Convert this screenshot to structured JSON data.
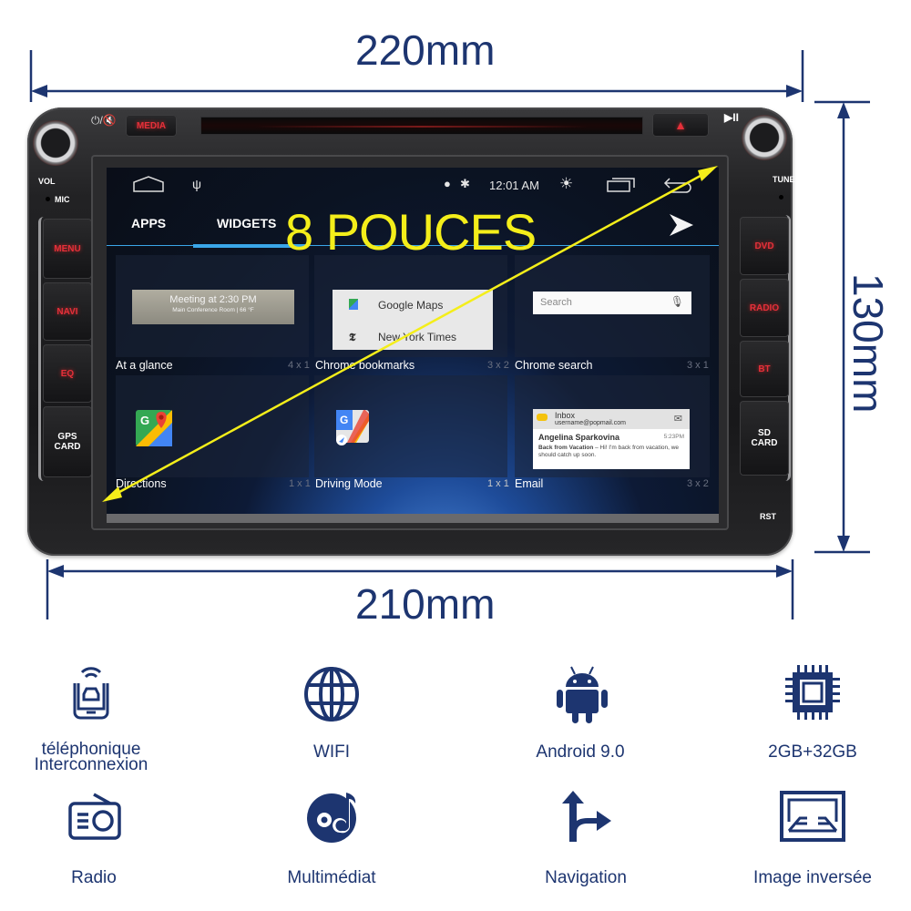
{
  "dimensions": {
    "width_top": "220mm",
    "height_right": "130mm",
    "width_bottom": "210mm",
    "screen_size_label": "8 POUCES"
  },
  "device": {
    "top_buttons": {
      "power_mute": "⏻/🔇",
      "media": "MEDIA",
      "eject": "▲",
      "play_pause": "▶II"
    },
    "knob_labels": {
      "left": "VOL",
      "mic": "MIC",
      "right": "TUNE",
      "reset": "RST"
    },
    "left_buttons": [
      "MENU",
      "NAVI",
      "EQ",
      "GPS CARD"
    ],
    "right_buttons": [
      "DVD",
      "RADIO",
      "BT",
      "SD CARD"
    ]
  },
  "screen": {
    "status_bar": {
      "time": "12:01 AM"
    },
    "tabs": [
      {
        "label": "APPS",
        "active": false
      },
      {
        "label": "WIDGETS",
        "active": true
      }
    ],
    "widgets": [
      {
        "name": "At a glance",
        "size": "4 x 1",
        "preview": {
          "title": "Meeting at 2:30 PM",
          "subtitle": "Main Conference Room | 66 °F"
        }
      },
      {
        "name": "Chrome bookmarks",
        "size": "3 x 2",
        "preview": {
          "items": [
            "Google Maps",
            "New York Times"
          ]
        }
      },
      {
        "name": "Chrome search",
        "size": "3 x 1",
        "preview": {
          "placeholder": "Search"
        }
      },
      {
        "name": "Directions",
        "size": "1 x 1"
      },
      {
        "name": "Driving Mode",
        "size": "1 x 1"
      },
      {
        "name": "Email",
        "size": "3 x 2",
        "preview": {
          "inbox": "Inbox",
          "account": "username@popmail.com",
          "sender": "Angelina Sparkovina",
          "time": "5:23PM",
          "subject": "Back from Vacation",
          "snippet": "– Hi! I'm back from vacation, we should catch up soon."
        }
      }
    ]
  },
  "features": [
    {
      "icon": "phone-car-link-icon",
      "label": "téléphonique Interconnexion"
    },
    {
      "icon": "globe-icon",
      "label": "WIFI"
    },
    {
      "icon": "android-icon",
      "label": "Android 9.0"
    },
    {
      "icon": "chip-icon",
      "label": "2GB+32GB"
    },
    {
      "icon": "radio-icon",
      "label": "Radio"
    },
    {
      "icon": "music-disc-icon",
      "label": "Multimédiat"
    },
    {
      "icon": "navigation-arrow-icon",
      "label": "Navigation"
    },
    {
      "icon": "rear-camera-icon",
      "label": "Image inversée"
    }
  ],
  "colors": {
    "accent_navy": "#1d3570",
    "overlay_yellow": "#f4ee1a",
    "button_red": "#e5303a",
    "tab_blue": "#3aa6e8"
  }
}
